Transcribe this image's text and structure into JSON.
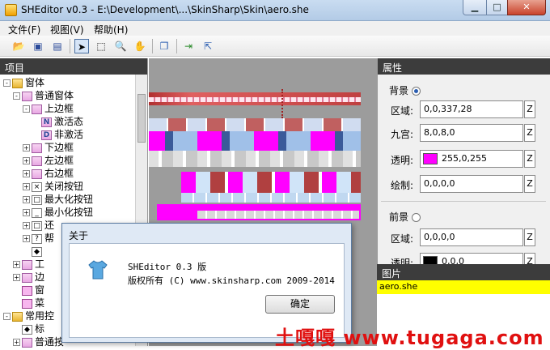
{
  "window": {
    "title": "SHEditor v0.3 - E:\\Development\\...\\SkinSharp\\Skin\\aero.she"
  },
  "menu": [
    "文件(F)",
    "视图(V)",
    "帮助(H)"
  ],
  "left_panel": {
    "title": "项目",
    "tree": [
      {
        "label": "窗体",
        "level": 0,
        "expander": "-",
        "icon": "folder"
      },
      {
        "label": "普通窗体",
        "level": 1,
        "expander": "-",
        "icon": "win"
      },
      {
        "label": "上边框",
        "level": 2,
        "expander": "-",
        "icon": "win"
      },
      {
        "label": "激活态",
        "level": 3,
        "icon": "N"
      },
      {
        "label": "非激活",
        "level": 3,
        "icon": "D"
      },
      {
        "label": "下边框",
        "level": 2,
        "expander": "+",
        "icon": "win"
      },
      {
        "label": "左边框",
        "level": 2,
        "expander": "+",
        "icon": "win"
      },
      {
        "label": "右边框",
        "level": 2,
        "expander": "+",
        "icon": "win"
      },
      {
        "label": "关闭按钮",
        "level": 2,
        "expander": "+",
        "icon": "×"
      },
      {
        "label": "最大化按钮",
        "level": 2,
        "expander": "+",
        "icon": "□"
      },
      {
        "label": "最小化按钮",
        "level": 2,
        "expander": "+",
        "icon": "_"
      },
      {
        "label": "还",
        "level": 2,
        "expander": "+",
        "icon": "□"
      },
      {
        "label": "帮",
        "level": 2,
        "expander": "+",
        "icon": "?"
      },
      {
        "label": "",
        "level": 2,
        "icon": "◆"
      },
      {
        "label": "工",
        "level": 1,
        "expander": "+",
        "icon": "win"
      },
      {
        "label": "边",
        "level": 1,
        "expander": "+",
        "icon": "win"
      },
      {
        "label": "窗",
        "level": 1,
        "icon": "pink"
      },
      {
        "label": "菜",
        "level": 1,
        "icon": "pink"
      },
      {
        "label": "常用控",
        "level": 0,
        "expander": "-",
        "icon": "folder"
      },
      {
        "label": "标",
        "level": 1,
        "icon": "◆"
      },
      {
        "label": "普通按",
        "level": 1,
        "expander": "+",
        "icon": "win"
      }
    ]
  },
  "props": {
    "title": "属性",
    "bg_label": "背景",
    "fg_label": "前景",
    "fields": [
      {
        "label": "区域:",
        "value": "0,0,337,28"
      },
      {
        "label": "九宫:",
        "value": "8,0,8,0"
      },
      {
        "label": "透明:",
        "value": "255,0,255",
        "swatch": "#ff00ff"
      },
      {
        "label": "绘制:",
        "value": "0,0,0,0"
      }
    ],
    "fg_fields": [
      {
        "label": "区域:",
        "value": "0,0,0,0"
      },
      {
        "label": "透明:",
        "value": "0,0,0",
        "swatch": "#000000"
      }
    ],
    "z_button": "Z"
  },
  "images": {
    "title": "图片",
    "item": "aero.she"
  },
  "dialog": {
    "title": "关于",
    "line1": "SHEditor 0.3 版",
    "line2": "版权所有 (C) www.skinsharp.com 2009-2014",
    "ok": "确定"
  },
  "watermark": "土嘎嘎 www.tugaga.com"
}
